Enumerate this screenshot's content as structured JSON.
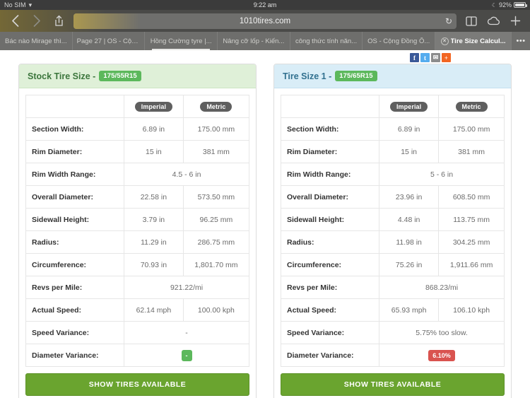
{
  "status_bar": {
    "carrier": "No SIM",
    "wifi_icon": "wifi-icon",
    "time": "9:22 am",
    "moon_icon": "moon-icon",
    "battery_percent": "92%",
    "battery_icon": "battery-icon"
  },
  "toolbar": {
    "back_icon": "chevron-left-icon",
    "forward_icon": "chevron-right-icon",
    "share_icon": "share-icon",
    "url": "1010tires.com",
    "reload_icon": "reload-icon",
    "tabs_icon": "tab-view-icon",
    "cloud_icon": "icloud-tabs-icon",
    "newtab_icon": "plus-icon"
  },
  "tabs": [
    {
      "label": "Bác nào Mirage thì...",
      "active": false
    },
    {
      "label": "Page 27 | OS - Cộn...",
      "active": false
    },
    {
      "label": "Hồng Cường tyre |...",
      "active": false
    },
    {
      "label": "Nâng cỡ lốp - Kiến...",
      "active": false
    },
    {
      "label": "công thức tính năn...",
      "active": false
    },
    {
      "label": "OS - Cộng Đồng Ô...",
      "active": false
    },
    {
      "label": "Tire Size Calcul...",
      "active": true
    }
  ],
  "tab_more_label": "•••",
  "share_buttons": [
    {
      "name": "facebook-share",
      "glyph": "f",
      "color": "#3b5998"
    },
    {
      "name": "twitter-share",
      "glyph": "t",
      "color": "#55acee"
    },
    {
      "name": "email-share",
      "glyph": "✉",
      "color": "#8c8c8c"
    },
    {
      "name": "more-share",
      "glyph": "+",
      "color": "#f26522"
    }
  ],
  "column_headers": {
    "blank": "",
    "imperial": "Imperial",
    "metric": "Metric"
  },
  "panels": [
    {
      "id": "stock",
      "title": "Stock Tire Size -",
      "size": "175/55R15",
      "theme": "green",
      "rows": [
        {
          "label": "Section Width:",
          "imperial": "6.89 in",
          "metric": "175.00 mm",
          "span": false
        },
        {
          "label": "Rim Diameter:",
          "imperial": "15 in",
          "metric": "381 mm",
          "span": false
        },
        {
          "label": "Rim Width Range:",
          "value": "4.5 - 6 in",
          "span": true
        },
        {
          "label": "Overall Diameter:",
          "imperial": "22.58 in",
          "metric": "573.50 mm",
          "span": false
        },
        {
          "label": "Sidewall Height:",
          "imperial": "3.79 in",
          "metric": "96.25 mm",
          "span": false
        },
        {
          "label": "Radius:",
          "imperial": "11.29 in",
          "metric": "286.75 mm",
          "span": false
        },
        {
          "label": "Circumference:",
          "imperial": "70.93 in",
          "metric": "1,801.70 mm",
          "span": false
        },
        {
          "label": "Revs per Mile:",
          "value": "921.22/mi",
          "span": true
        },
        {
          "label": "Actual Speed:",
          "imperial": "62.14 mph",
          "metric": "100.00 kph",
          "span": false
        },
        {
          "label": "Speed Variance:",
          "value": "-",
          "span": true
        },
        {
          "label": "Diameter Variance:",
          "value": "-",
          "span": true,
          "chip": "green"
        }
      ],
      "button": "SHOW TIRES AVAILABLE"
    },
    {
      "id": "size1",
      "title": "Tire Size 1 -",
      "size": "175/65R15",
      "theme": "blue",
      "rows": [
        {
          "label": "Section Width:",
          "imperial": "6.89 in",
          "metric": "175.00 mm",
          "span": false
        },
        {
          "label": "Rim Diameter:",
          "imperial": "15 in",
          "metric": "381 mm",
          "span": false
        },
        {
          "label": "Rim Width Range:",
          "value": "5 - 6 in",
          "span": true
        },
        {
          "label": "Overall Diameter:",
          "imperial": "23.96 in",
          "metric": "608.50 mm",
          "span": false
        },
        {
          "label": "Sidewall Height:",
          "imperial": "4.48 in",
          "metric": "113.75 mm",
          "span": false
        },
        {
          "label": "Radius:",
          "imperial": "11.98 in",
          "metric": "304.25 mm",
          "span": false
        },
        {
          "label": "Circumference:",
          "imperial": "75.26 in",
          "metric": "1,911.66 mm",
          "span": false
        },
        {
          "label": "Revs per Mile:",
          "value": "868.23/mi",
          "span": true
        },
        {
          "label": "Actual Speed:",
          "imperial": "65.93 mph",
          "metric": "106.10 kph",
          "span": false
        },
        {
          "label": "Speed Variance:",
          "value": "5.75% too slow.",
          "span": true
        },
        {
          "label": "Diameter Variance:",
          "value": "6.10%",
          "span": true,
          "chip": "red"
        }
      ],
      "button": "SHOW TIRES AVAILABLE"
    }
  ],
  "colors": {
    "green_accent": "#5cb85c",
    "red_accent": "#d9534f",
    "button_green": "#6aa42f",
    "panel_green_bg": "#dff0d8",
    "panel_blue_bg": "#d9edf7",
    "pill_gray": "#5f5f5f"
  }
}
